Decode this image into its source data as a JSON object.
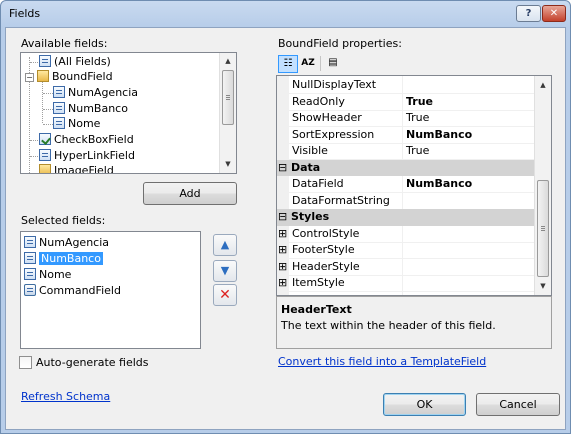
{
  "window": {
    "title": "Fields",
    "help_glyph": "?",
    "close_glyph": "✕"
  },
  "available": {
    "label": "Available fields:",
    "items": [
      {
        "label": "(All Fields)",
        "icon": "field-table-icon"
      },
      {
        "label": "BoundField",
        "icon": "boundfield-folder-icon"
      },
      {
        "label": "NumAgencia",
        "icon": "field-icon"
      },
      {
        "label": "NumBanco",
        "icon": "field-icon"
      },
      {
        "label": "Nome",
        "icon": "field-icon"
      },
      {
        "label": "CheckBoxField",
        "icon": "checkboxfield-icon"
      },
      {
        "label": "HyperLinkField",
        "icon": "hyperlinkfield-icon"
      },
      {
        "label": "ImageField",
        "icon": "imagefield-icon"
      }
    ],
    "expander_glyph": "−"
  },
  "add_button": "Add",
  "selected": {
    "label": "Selected fields:",
    "items": [
      {
        "label": "NumAgencia",
        "icon": "field-icon"
      },
      {
        "label": "NumBanco",
        "icon": "field-icon",
        "selected": true
      },
      {
        "label": "Nome",
        "icon": "field-icon"
      },
      {
        "label": "CommandField",
        "icon": "commandfield-icon"
      }
    ]
  },
  "move_buttons": {
    "up": "▲",
    "down": "▼",
    "delete": "✕"
  },
  "autogenerate": {
    "label": "Auto-generate fields",
    "checked": false
  },
  "refresh_schema": "Refresh Schema",
  "properties": {
    "label": "BoundField properties:",
    "toolbar": {
      "categorized": "☷",
      "alphabetical": "AZ",
      "pages": "▤"
    },
    "rows": [
      {
        "type": "prop",
        "name": "NullDisplayText",
        "value": "",
        "bold": false
      },
      {
        "type": "prop",
        "name": "ReadOnly",
        "value": "True",
        "bold": true
      },
      {
        "type": "prop",
        "name": "ShowHeader",
        "value": "True",
        "bold": false
      },
      {
        "type": "prop",
        "name": "SortExpression",
        "value": "NumBanco",
        "bold": true
      },
      {
        "type": "prop",
        "name": "Visible",
        "value": "True",
        "bold": false
      },
      {
        "type": "cat",
        "name": "Data",
        "glyph": "⊟"
      },
      {
        "type": "prop",
        "name": "DataField",
        "value": "NumBanco",
        "bold": true
      },
      {
        "type": "prop",
        "name": "DataFormatString",
        "value": "",
        "bold": false
      },
      {
        "type": "cat",
        "name": "Styles",
        "glyph": "⊟"
      },
      {
        "type": "expand",
        "name": "ControlStyle",
        "value": "",
        "glyph": "⊞"
      },
      {
        "type": "expand",
        "name": "FooterStyle",
        "value": "",
        "glyph": "⊞"
      },
      {
        "type": "expand",
        "name": "HeaderStyle",
        "value": "",
        "glyph": "⊞"
      },
      {
        "type": "expand",
        "name": "ItemStyle",
        "value": "",
        "glyph": "⊞"
      }
    ],
    "help_title": "HeaderText",
    "help_text": "The text within the header of this field."
  },
  "convert_link": "Convert this field into a TemplateField",
  "ok_button": "OK",
  "cancel_button": "Cancel",
  "scroll": {
    "up": "▲",
    "down": "▼"
  }
}
